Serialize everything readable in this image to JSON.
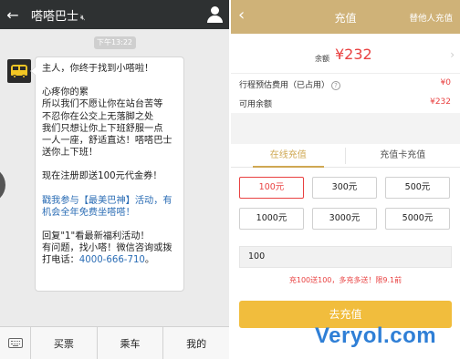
{
  "chat": {
    "title": "嗒嗒巴士",
    "timestamp": "下午13:22",
    "messages": {
      "p1": "主人，你终于找到小嗒啦！",
      "p2": "心疼你的累\n所以我们不愿让你在站台苦等\n不忍你在公交上无落脚之处\n我们只想让你上下班舒服一点\n一人一座，舒适直达！嗒嗒巴士送你上下班！",
      "p3": "现在注册即送100元代金券！",
      "p4": "戳我参与【最美巴神】活动，有机会全年免费坐嗒嗒！",
      "p5_prefix": "回复\"1\"看最新福利活动！\n有问题，找小嗒！微信咨询或拨打电话：",
      "p5_phone": "4000-666-710",
      "p5_suffix": "。"
    },
    "menu": [
      "买票",
      "乘车",
      "我的"
    ]
  },
  "pay": {
    "title": "充值",
    "other_recharge": "替他人充值",
    "balance_label": "余额",
    "balance_value": "¥232",
    "trip_fee_label": "行程预估费用（已占用）",
    "trip_fee_value": "¥0",
    "available_label": "可用余额",
    "available_value": "¥232",
    "tabs": [
      "在线充值",
      "充值卡充值"
    ],
    "amounts": [
      "100元",
      "300元",
      "500元",
      "1000元",
      "3000元",
      "5000元"
    ],
    "selected_amount_index": 0,
    "input_value": "100",
    "promo": "充100送100，多充多送！限9.1前",
    "submit": "去充值"
  },
  "watermark": "Veryol.com",
  "colors": {
    "chat_header": "#2e3132",
    "pay_header": "#cfb278",
    "accent_red": "#e94141",
    "button_yellow": "#f1bd3d",
    "tab_gold": "#cfa852",
    "link_blue": "#2b6db5"
  },
  "icons": [
    "back-arrow-icon",
    "profile-icon",
    "do-not-disturb-icon",
    "keyboard-icon",
    "help-icon",
    "chevron-right-icon",
    "bus-avatar-icon"
  ]
}
